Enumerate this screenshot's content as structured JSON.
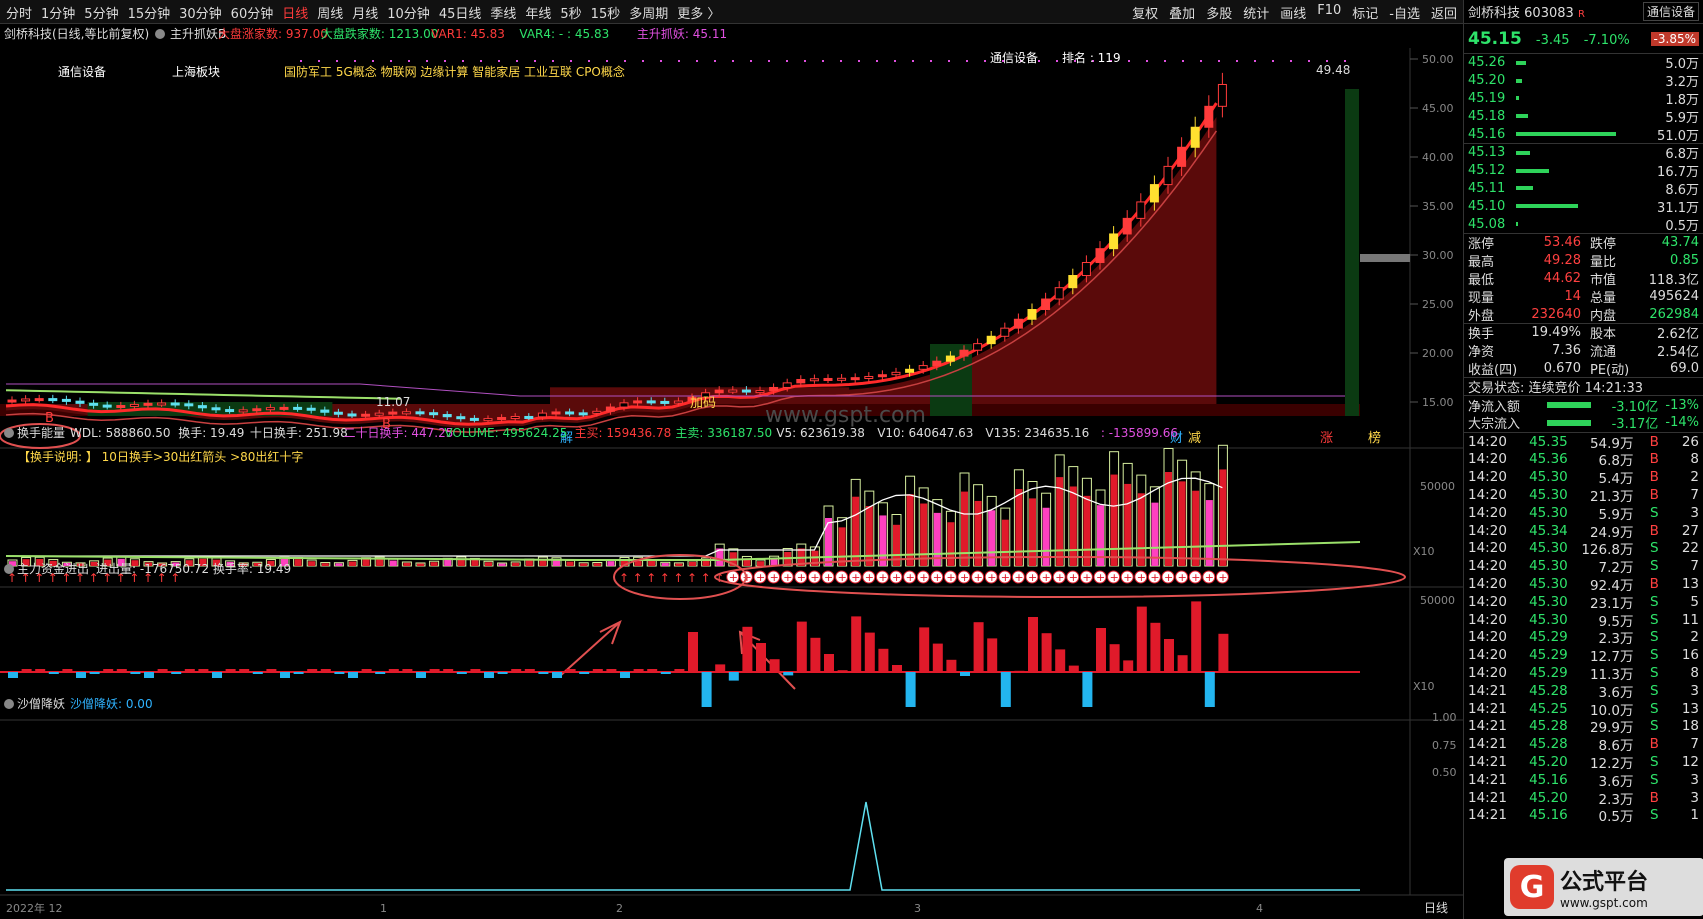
{
  "toolbar": {
    "periods": [
      "分时",
      "1分钟",
      "5分钟",
      "15分钟",
      "30分钟",
      "60分钟",
      "日线",
      "周线",
      "月线",
      "10分钟",
      "45日线",
      "季线",
      "年线",
      "5秒",
      "15秒",
      "多周期",
      "更多 〉"
    ],
    "active_period": "日线",
    "tools": [
      "复权",
      "叠加",
      "多股",
      "统计",
      "画线",
      "F10",
      "标记",
      "-自选",
      "返回"
    ]
  },
  "main_panel": {
    "title": "剑桥科技(日线,等比前复权)",
    "indicator_name": "主升抓妖B",
    "indicator_values": [
      {
        "text": "大盘涨家数: 937.00",
        "color": "#ff3b3b"
      },
      {
        "text": "大盘跌家数: 1213.00",
        "color": "#2ee36a"
      },
      {
        "text": "VAR1: 45.83",
        "color": "#ff3b3b"
      },
      {
        "text": "VAR4: - : 45.83",
        "color": "#2ee36a"
      },
      {
        "text": "主升抓妖: 45.11",
        "color": "#e050e0"
      }
    ],
    "tags": [
      "通信设备",
      "上海板块",
      "国防军工 5G概念 物联网 边缘计算 智能家居 工业互联 CPO概念"
    ],
    "industry": "通信设备",
    "rank_label": "排名 : 119",
    "price_axis": [
      "50.00",
      "45.00",
      "40.00",
      "35.00",
      "30.00",
      "25.00",
      "20.00",
      "15.00"
    ],
    "high_label": "49.48",
    "low_label": "11.07",
    "markers": [
      "B",
      "B",
      "解",
      "加码",
      "财",
      "减",
      "涨",
      "榜"
    ],
    "watermark": "www.gspt.com"
  },
  "panel2": {
    "title": "换手能量",
    "values": [
      {
        "text": "WDL: 588860.50",
        "color": "#ddd"
      },
      {
        "text": "换手: 19.49",
        "color": "#ddd"
      },
      {
        "text": "十日换手: 251.98",
        "color": "#ddd"
      },
      {
        "text": "二十日换手: 447.25",
        "color": "#e050e0"
      },
      {
        "text": "VOLUME: 495624.25",
        "color": "#2ee36a"
      },
      {
        "text": "主买: 159436.78",
        "color": "#ff3b3b"
      },
      {
        "text": "主卖: 336187.50",
        "color": "#2ee36a"
      },
      {
        "text": "V5: 623619.38",
        "color": "#ddd"
      },
      {
        "text": "V10: 640647.63",
        "color": "#ddd"
      },
      {
        "text": "V135: 234635.16",
        "color": "#ddd"
      },
      {
        "text": ": -135899.66",
        "color": "#e050e0"
      }
    ],
    "note": "【换手说明: 】   10日换手>30出红箭头    >80出红十字",
    "axis": "50000",
    "unit": "X10"
  },
  "panel3": {
    "title": "主力资金进出",
    "values": "进出量: -176750.72  换手率: 19.49",
    "axis": "50000",
    "unit": "X10"
  },
  "panel4": {
    "title": "沙僧降妖",
    "value": "沙僧降妖: 0.00",
    "axis": [
      "1.00",
      "0.75",
      "0.50"
    ]
  },
  "xaxis": {
    "labels": [
      "2022年 12",
      "1",
      "2",
      "3",
      "4"
    ],
    "period": "日线"
  },
  "sidebar": {
    "name": "剑桥科技",
    "code": "603083",
    "badge": "R",
    "industry": "通信设备",
    "price": "45.15",
    "change": "-3.45",
    "change_pct": "-7.10%",
    "sector_pct": "-3.85%",
    "asks": [
      {
        "price": "45.26",
        "vol": "5.0万",
        "w": 10
      },
      {
        "price": "45.20",
        "vol": "3.2万",
        "w": 6
      },
      {
        "price": "45.19",
        "vol": "1.8万",
        "w": 3
      },
      {
        "price": "45.18",
        "vol": "5.9万",
        "w": 12
      },
      {
        "price": "45.16",
        "vol": "51.0万",
        "w": 100
      }
    ],
    "bids": [
      {
        "price": "45.13",
        "vol": "6.8万",
        "w": 14
      },
      {
        "price": "45.12",
        "vol": "16.7万",
        "w": 33
      },
      {
        "price": "45.11",
        "vol": "8.6万",
        "w": 17
      },
      {
        "price": "45.10",
        "vol": "31.1万",
        "w": 62
      },
      {
        "price": "45.08",
        "vol": "0.5万",
        "w": 2
      }
    ],
    "stats": [
      [
        "涨停",
        "53.46",
        "cr",
        "跌停",
        "43.74",
        "cg"
      ],
      [
        "最高",
        "49.28",
        "cr",
        "量比",
        "0.85",
        "cg"
      ],
      [
        "最低",
        "44.62",
        "cr",
        "市值",
        "118.3亿",
        "cw"
      ],
      [
        "现量",
        "14",
        "cr",
        "总量",
        "495624",
        "cw"
      ],
      [
        "外盘",
        "232640",
        "cr",
        "内盘",
        "262984",
        "cg"
      ]
    ],
    "stats2": [
      [
        "换手",
        "19.49%",
        "cw",
        "股本",
        "2.62亿",
        "cw"
      ],
      [
        "净资",
        "7.36",
        "cw",
        "流通",
        "2.54亿",
        "cw"
      ],
      [
        "收益(四)",
        "0.670",
        "cw",
        "PE(动)",
        "69.0",
        "cw"
      ]
    ],
    "trade_status": "交易状态: 连续竞价 14:21:33",
    "flows": [
      [
        "净流入额",
        "-3.10亿",
        "-13%"
      ],
      [
        "大宗流入",
        "-3.17亿",
        "-14%"
      ]
    ],
    "ticks": [
      [
        "14:20",
        "45.35",
        "54.9万",
        "B",
        "26"
      ],
      [
        "14:20",
        "45.36",
        "6.8万",
        "B",
        "8"
      ],
      [
        "14:20",
        "45.30",
        "5.4万",
        "B",
        "2"
      ],
      [
        "14:20",
        "45.30",
        "21.3万",
        "B",
        "7"
      ],
      [
        "14:20",
        "45.30",
        "5.9万",
        "S",
        "3"
      ],
      [
        "14:20",
        "45.34",
        "24.9万",
        "B",
        "27"
      ],
      [
        "14:20",
        "45.30",
        "126.8万",
        "S",
        "22"
      ],
      [
        "14:20",
        "45.30",
        "7.2万",
        "S",
        "7"
      ],
      [
        "14:20",
        "45.30",
        "92.4万",
        "B",
        "13"
      ],
      [
        "14:20",
        "45.30",
        "23.1万",
        "S",
        "5"
      ],
      [
        "14:20",
        "45.30",
        "9.5万",
        "S",
        "11"
      ],
      [
        "14:20",
        "45.29",
        "2.3万",
        "S",
        "2"
      ],
      [
        "14:20",
        "45.29",
        "12.7万",
        "S",
        "16"
      ],
      [
        "14:20",
        "45.29",
        "11.3万",
        "S",
        "8"
      ],
      [
        "14:21",
        "45.28",
        "3.6万",
        "S",
        "3"
      ],
      [
        "14:21",
        "45.25",
        "10.0万",
        "S",
        "13"
      ],
      [
        "14:21",
        "45.28",
        "29.9万",
        "S",
        "18"
      ],
      [
        "14:21",
        "45.28",
        "8.6万",
        "B",
        "7"
      ],
      [
        "14:21",
        "45.20",
        "12.2万",
        "S",
        "12"
      ],
      [
        "14:21",
        "45.16",
        "3.6万",
        "S",
        "3"
      ],
      [
        "14:21",
        "45.20",
        "2.3万",
        "B",
        "3"
      ],
      [
        "14:21",
        "45.16",
        "0.5万",
        "S",
        "1"
      ]
    ],
    "logo": "公式平台",
    "logo_url": "www.gspt.com"
  },
  "colors": {
    "up": "#ff3b3b",
    "down": "#2ee36a",
    "cyan": "#5fe0f0",
    "yellow": "#ffe030",
    "magenta": "#e050e0"
  }
}
